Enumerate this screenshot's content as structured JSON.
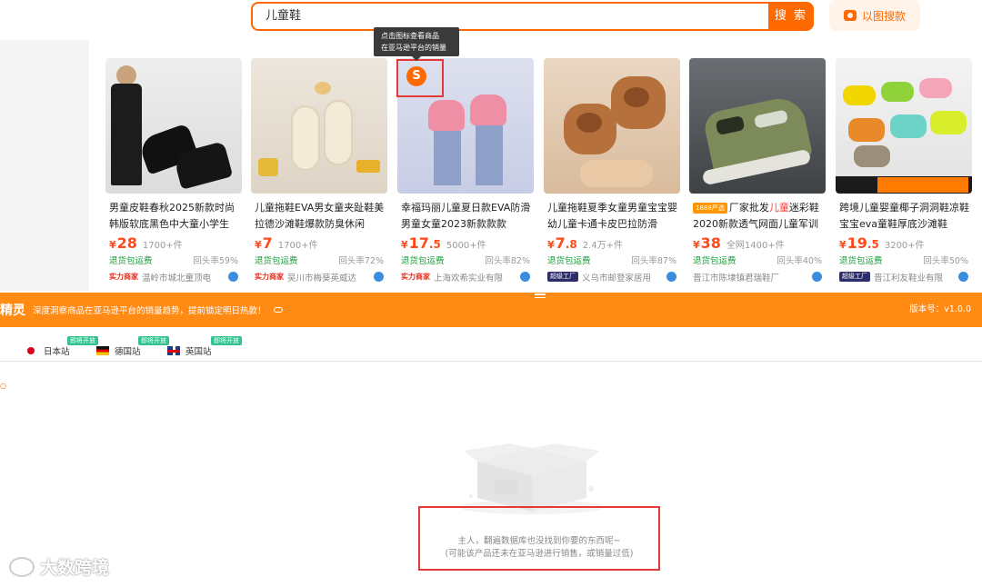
{
  "search": {
    "query": "儿童鞋",
    "button_label": "搜 索",
    "image_search_label": "以图搜款"
  },
  "tooltip": {
    "line1": "点击图标查看商品",
    "line2": "在亚马逊平台的销量"
  },
  "products": [
    {
      "title_before": "男童皮鞋春秋2025新款时尚韩版软底黑色中大童小学生",
      "title_hl": "",
      "title_after": "",
      "price_int": "28",
      "price_dec": "",
      "sold": "1700+件",
      "refund": "退货包运费",
      "repurchase": "回头率59%",
      "shop_tag": "实力商家",
      "shop": "温岭市城北童顶电"
    },
    {
      "title_before": "儿童拖鞋EVA男女童夹趾鞋美拉德沙滩鞋爆款防臭休闲",
      "title_hl": "",
      "title_after": "",
      "price_int": "7",
      "price_dec": "",
      "sold": "1700+件",
      "refund": "退货包运费",
      "repurchase": "回头率72%",
      "shop_tag": "实力商家",
      "shop": "吴川市梅葵英威达"
    },
    {
      "title_before": "幸福玛丽儿童夏日款EVA防滑男童女童2023新款款款",
      "title_hl": "",
      "title_after": "",
      "price_int": "17",
      "price_dec": ".5",
      "sold": "5000+件",
      "refund": "退货包运费",
      "repurchase": "回头率82%",
      "shop_tag": "实力商家",
      "shop": "上海欢希实业有限"
    },
    {
      "title_before": "儿童拖鞋夏季女童男童宝宝婴幼儿童卡通卡皮巴拉防滑",
      "title_hl": "",
      "title_after": "",
      "price_int": "7",
      "price_dec": ".8",
      "sold": "2.4万+件",
      "refund": "退货包运费",
      "repurchase": "回头率87%",
      "shop_tag": "超级工厂",
      "shop": "义乌市邮登家居用"
    },
    {
      "title_before": "厂家批发",
      "title_hl": "儿童",
      "title_after": "迷彩鞋2020新款透气网面儿童军训",
      "price_int": "38",
      "price_dec": "",
      "sold": "全网1400+件",
      "refund": "退货包运费",
      "repurchase": "回头率40%",
      "shop_tag": "",
      "shop": "晋江市陈埭镇君瑞鞋厂",
      "badge": "1688严选"
    },
    {
      "title_before": "跨境儿童婴童椰子洞洞鞋凉鞋宝宝eva童鞋厚底沙滩鞋",
      "title_hl": "",
      "title_after": "",
      "price_int": "19",
      "price_dec": ".5",
      "sold": "3200+件",
      "refund": "退货包运费",
      "repurchase": "回头率50%",
      "shop_tag": "超级工厂",
      "shop": "晋江利友鞋业有限"
    }
  ],
  "plugin_bar": {
    "brand": "精灵",
    "desc": "深度洞察商品在亚马逊平台的销量趋势，提前锁定明日热款！",
    "version": "版本号：v1.0.0"
  },
  "stations": [
    {
      "name": "日本站",
      "badge": "即将开放"
    },
    {
      "name": "德国站",
      "badge": "即将开放"
    },
    {
      "name": "英国站",
      "badge": "即将开放"
    }
  ],
  "empty_state": {
    "line1": "主人，翻遍数据库也没找到你要的东西呢~",
    "line2": "(可能该产品还未在亚马逊进行销售，或销量过低)"
  },
  "watermark": "大数跨境",
  "colors": {
    "accent": "#ff6a00",
    "bar": "#ff8a14",
    "price": "#ff4a1a",
    "refund": "#1a9c3a",
    "highlight_box": "#e53935"
  }
}
